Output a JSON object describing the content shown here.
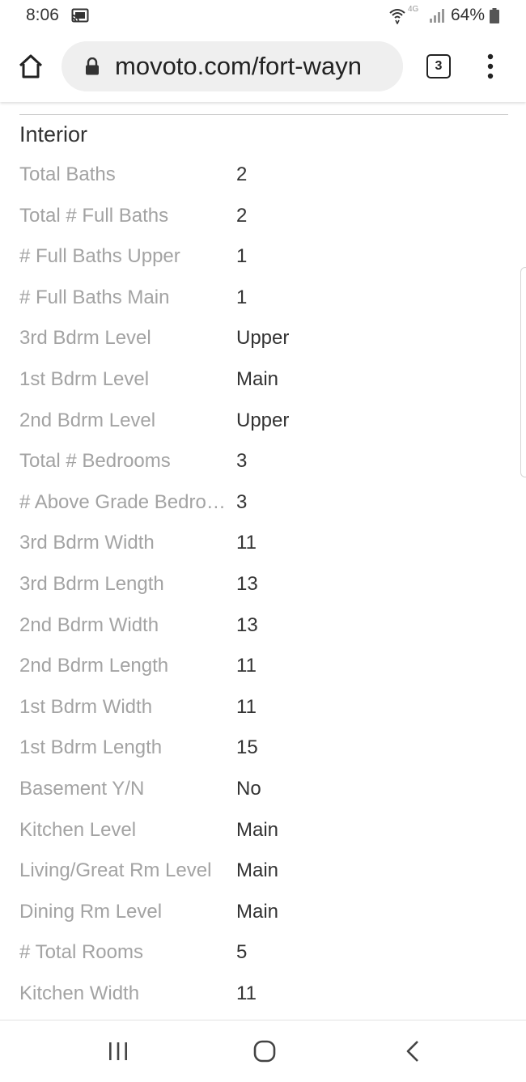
{
  "status_bar": {
    "time": "8:06",
    "network": "4G",
    "battery": "64%",
    "icons": [
      "cast-icon",
      "wifi-calling-icon",
      "signal-icon",
      "battery-icon"
    ]
  },
  "browser": {
    "url": "movoto.com/fort-wayn",
    "tab_count": "3",
    "icons": [
      "home-icon",
      "lock-icon",
      "tabs-icon",
      "more-vert-icon"
    ]
  },
  "section": {
    "title": "Interior",
    "rows": [
      {
        "label": "Total Baths",
        "value": "2"
      },
      {
        "label": "Total # Full Baths",
        "value": "2"
      },
      {
        "label": "# Full Baths Upper",
        "value": "1"
      },
      {
        "label": "# Full Baths Main",
        "value": "1"
      },
      {
        "label": "3rd Bdrm Level",
        "value": "Upper"
      },
      {
        "label": "1st Bdrm Level",
        "value": "Main"
      },
      {
        "label": "2nd Bdrm Level",
        "value": "Upper"
      },
      {
        "label": "Total # Bedrooms",
        "value": "3"
      },
      {
        "label": "# Above Grade Bedroo...",
        "value": "3"
      },
      {
        "label": "3rd Bdrm Width",
        "value": "11"
      },
      {
        "label": "3rd Bdrm Length",
        "value": "13"
      },
      {
        "label": "2nd Bdrm Width",
        "value": "13"
      },
      {
        "label": "2nd Bdrm Length",
        "value": "11"
      },
      {
        "label": "1st Bdrm Width",
        "value": "11"
      },
      {
        "label": "1st Bdrm Length",
        "value": "15"
      },
      {
        "label": "Basement Y/N",
        "value": "No"
      },
      {
        "label": "Kitchen Level",
        "value": "Main"
      },
      {
        "label": "Living/Great Rm Level",
        "value": "Main"
      },
      {
        "label": "Dining Rm Level",
        "value": "Main"
      },
      {
        "label": "# Total Rooms",
        "value": "5"
      },
      {
        "label": "Kitchen Width",
        "value": "11"
      }
    ]
  },
  "nav_bar": {
    "icons": [
      "recent-apps-icon",
      "home-button-icon",
      "back-icon"
    ]
  },
  "colors": {
    "label": "#a3a3a3",
    "value": "#333333",
    "url_pill": "#efefef",
    "divider": "#cfcfcf"
  }
}
